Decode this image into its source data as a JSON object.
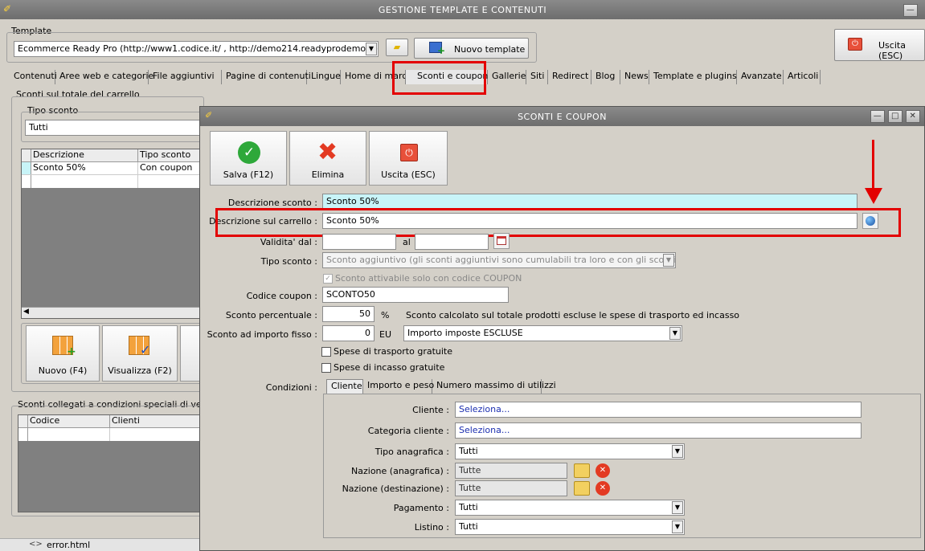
{
  "main_window": {
    "title": "GESTIONE TEMPLATE E CONTENUTI",
    "template_group_label": "Template",
    "template_value": "Ecommerce Ready Pro (http://www1.codice.it/ , http://demo214.readyprodemo.it)",
    "new_template_label": "Nuovo template",
    "exit_label": "Uscita (ESC)",
    "tabs": [
      "Contenuti",
      "Aree web e categorie",
      "File aggiuntivi",
      "Pagine di contenuti",
      "Lingue",
      "Home di marca",
      "Sconti e coupon",
      "Gallerie",
      "Siti",
      "Redirect",
      "Blog",
      "News",
      "Template e plugins",
      "Avanzate",
      "Articoli"
    ],
    "active_tab": "Sconti e coupon",
    "cart_discount_group": "Sconti sul totale del carrello",
    "tipo_sconto_label": "Tipo sconto",
    "tipo_sconto_value": "Tutti",
    "grid_headers": [
      "Descrizione",
      "Tipo sconto"
    ],
    "grid_rows": [
      [
        "Sconto 50%",
        "Con coupon"
      ]
    ],
    "new_button": "Nuovo (F4)",
    "view_button": "Visualizza (F2)",
    "special_group": "Sconti collegati a condizioni speciali di vendita",
    "special_headers": [
      "Codice",
      "Clienti"
    ],
    "status_file": "error.html"
  },
  "dialog": {
    "title": "SCONTI E COUPON",
    "save_label": "Salva (F12)",
    "delete_label": "Elimina",
    "exit_label": "Uscita (ESC)",
    "descrizione_sconto_label": "Descrizione sconto :",
    "descrizione_sconto_value": "Sconto 50%",
    "descrizione_carrello_label": "Descrizione sul carrello :",
    "descrizione_carrello_value": "Sconto 50%",
    "validita_label": "Validita' dal :",
    "al_label": "al",
    "tipo_sconto_label": "Tipo sconto :",
    "tipo_sconto_value": "Sconto aggiuntivo (gli sconti aggiuntivi sono cumulabili tra loro e con gli sconti primari)",
    "coupon_only_label": "Sconto attivabile solo con codice COUPON",
    "codice_coupon_label": "Codice coupon :",
    "codice_coupon_value": "SCONTO50",
    "sconto_percentuale_label": "Sconto percentuale :",
    "sconto_percentuale_value": "50",
    "percent_sign": "%",
    "sconto_note": "Sconto calcolato sul totale prodotti escluse le spese di trasporto ed incasso",
    "sconto_importo_label": "Sconto ad importo fisso :",
    "sconto_importo_value": "0",
    "currency": "EU",
    "imposte_value": "Importo imposte ESCLUSE",
    "spese_trasporto_label": "Spese di trasporto gratuite",
    "spese_incasso_label": "Spese di incasso gratuite",
    "condizioni_label": "Condizioni :",
    "cond_tabs": [
      "Cliente",
      "Importo e peso",
      "Numero massimo di utilizzi"
    ],
    "cliente_label": "Cliente :",
    "cliente_value": "Seleziona...",
    "categoria_label": "Categoria cliente :",
    "categoria_value": "Seleziona...",
    "tipo_anagrafica_label": "Tipo anagrafica :",
    "tipo_anagrafica_value": "Tutti",
    "nazione_anag_label": "Nazione (anagrafica) :",
    "nazione_anag_value": "Tutte",
    "nazione_dest_label": "Nazione (destinazione) :",
    "nazione_dest_value": "Tutte",
    "pagamento_label": "Pagamento :",
    "pagamento_value": "Tutti",
    "listino_label": "Listino :",
    "listino_value": "Tutti"
  },
  "colors": {
    "highlight": "#e30000",
    "description_bg": "#c8f4f8",
    "link_blue": "#1c2fb0"
  }
}
